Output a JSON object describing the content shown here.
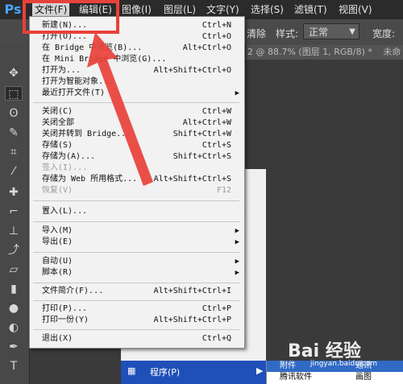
{
  "app": {
    "logo_text": "Ps"
  },
  "menubar": {
    "items": [
      {
        "label": "文件(F)",
        "active": true
      },
      {
        "label": "编辑(E)"
      },
      {
        "label": "图像(I)"
      },
      {
        "label": "图层(L)"
      },
      {
        "label": "文字(Y)"
      },
      {
        "label": "选择(S)"
      },
      {
        "label": "滤镜(T)"
      },
      {
        "label": "视图(V)"
      }
    ]
  },
  "optionsbar": {
    "clear_label": "清除",
    "style_label": "样式:",
    "style_value": "正常",
    "width_label": "宽度:"
  },
  "document": {
    "tab_text": "2 @ 88.7% (图层 1, RGB/8) *",
    "tab2_text": "未命"
  },
  "file_menu": {
    "items": [
      {
        "label": "新建(N)...",
        "shortcut": "Ctrl+N"
      },
      {
        "label": "打开(O)...",
        "shortcut": "Ctrl+O"
      },
      {
        "label": "在 Bridge 中浏览(B)...",
        "shortcut": "Alt+Ctrl+O"
      },
      {
        "label": "在 Mini Bridge 中浏览(G)...",
        "shortcut": ""
      },
      {
        "label": "打开为...",
        "shortcut": "Alt+Shift+Ctrl+O"
      },
      {
        "label": "打开为智能对象...",
        "shortcut": ""
      },
      {
        "label": "最近打开文件(T)",
        "shortcut": "",
        "submenu": true
      },
      {
        "label": "关闭(C)",
        "shortcut": "Ctrl+W"
      },
      {
        "label": "关闭全部",
        "shortcut": "Alt+Ctrl+W"
      },
      {
        "label": "关闭并转到 Bridge...",
        "shortcut": "Shift+Ctrl+W"
      },
      {
        "label": "存储(S)",
        "shortcut": "Ctrl+S"
      },
      {
        "label": "存储为(A)...",
        "shortcut": "Shift+Ctrl+S"
      },
      {
        "label": "签入(I)...",
        "shortcut": "",
        "disabled": true
      },
      {
        "label": "存储为 Web 所用格式...",
        "shortcut": "Alt+Shift+Ctrl+S"
      },
      {
        "label": "恢复(V)",
        "shortcut": "F12",
        "disabled": true
      },
      {
        "label": "置入(L)...",
        "shortcut": ""
      },
      {
        "label": "导入(M)",
        "shortcut": "",
        "submenu": true
      },
      {
        "label": "导出(E)",
        "shortcut": "",
        "submenu": true
      },
      {
        "label": "自动(U)",
        "shortcut": "",
        "submenu": true
      },
      {
        "label": "脚本(R)",
        "shortcut": "",
        "submenu": true
      },
      {
        "label": "文件简介(F)...",
        "shortcut": "Alt+Shift+Ctrl+I"
      },
      {
        "label": "打印(P)...",
        "shortcut": "Ctrl+P"
      },
      {
        "label": "打印一份(Y)",
        "shortcut": "Alt+Shift+Ctrl+P"
      },
      {
        "label": "退出(X)",
        "shortcut": "Ctrl+Q"
      }
    ]
  },
  "taskbar": {
    "programs_label": "程序(P)",
    "sub_items": [
      "附件",
      "腾讯软件"
    ],
    "sub2_items": [
      "通讯",
      "画图"
    ]
  },
  "watermark": {
    "text": "Bai 经验",
    "sub": "jingyan.baidu.com"
  },
  "colors": {
    "highlight": "#e8413a",
    "menu_bg": "#f2f2f2",
    "ps_blue": "#4aa3ff"
  }
}
